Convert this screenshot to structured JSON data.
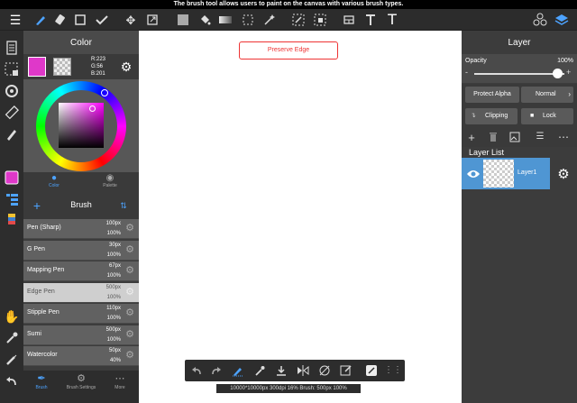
{
  "status_bar": {
    "message": "The brush tool allows users to paint on the canvas with various brush types."
  },
  "toolbar": {
    "tools": [
      "brush-tool-icon",
      "eraser-tool-icon",
      "select-rect-icon",
      "select-check-icon",
      "move-tool-icon",
      "transform-icon",
      "fill-color-icon",
      "bucket-icon",
      "gradient-icon",
      "lasso-icon",
      "magic-wand-icon",
      "select-pen-icon",
      "select-eraser-icon",
      "frame-icon",
      "text-icon"
    ],
    "right_icons": [
      "materials-icon",
      "layers-icon"
    ]
  },
  "left_tools": [
    "pages-icon",
    "selection-icon",
    "rotate-icon",
    "ruler-icon",
    "pen-fill-icon",
    "color-icon",
    "layer-list-icon",
    "palette-stack-icon",
    "hand-icon",
    "eyedropper-icon",
    "pen-icon",
    "undo-icon"
  ],
  "color_panel": {
    "title": "Color",
    "r_label": "R:223",
    "g_label": "G:56",
    "b_label": "B:201",
    "current_color": "#df38c9",
    "tabs": [
      {
        "label": "Color",
        "active": true
      },
      {
        "label": "Palette",
        "active": false
      }
    ]
  },
  "brush_panel": {
    "title": "Brush",
    "brushes": [
      {
        "name": "Pen (Sharp)",
        "size": "100px",
        "opacity": "100%",
        "selected": false
      },
      {
        "name": "G Pen",
        "size": "30px",
        "opacity": "100%",
        "selected": false
      },
      {
        "name": "Mapping Pen",
        "size": "67px",
        "opacity": "100%",
        "selected": false
      },
      {
        "name": "Edge Pen",
        "size": "500px",
        "opacity": "100%",
        "selected": true
      },
      {
        "name": "Stipple Pen",
        "size": "110px",
        "opacity": "100%",
        "selected": false
      },
      {
        "name": "Sumi",
        "size": "500px",
        "opacity": "100%",
        "selected": false
      },
      {
        "name": "Watercolor",
        "size": "50px",
        "opacity": "40%",
        "selected": false
      }
    ]
  },
  "bottom_tabs": [
    {
      "label": "Brush",
      "icon": "brush-tab-icon",
      "active": true
    },
    {
      "label": "Brush Settings",
      "icon": "brush-settings-icon",
      "active": false
    },
    {
      "label": "More",
      "icon": "more-icon",
      "active": false
    }
  ],
  "canvas": {
    "preserve_edge_label": "Preserve Edge",
    "info": "10000*10000px 300dpi 16% Brush: 500px 100%"
  },
  "bottom_bar": [
    "undo-icon",
    "redo-icon",
    "brush-quick-icon",
    "dropper-icon",
    "download-icon",
    "flip-icon",
    "no-snap-icon",
    "edit-icon",
    "reference-icon",
    "grid-icon"
  ],
  "layer_panel": {
    "title": "Layer",
    "opacity_label": "Opacity",
    "opacity_value": "100%",
    "opacity_fraction": 1.0,
    "protect_alpha": "Protect Alpha",
    "blend_mode": "Normal",
    "clipping": "Clipping",
    "lock": "Lock",
    "list_title": "Layer List",
    "layers": [
      {
        "name": "Layer1",
        "visible": true,
        "selected": true
      }
    ]
  },
  "colors": {
    "accent": "#3d8fd1",
    "selected_layer": "#4f96d3",
    "alert": "#e33333"
  }
}
